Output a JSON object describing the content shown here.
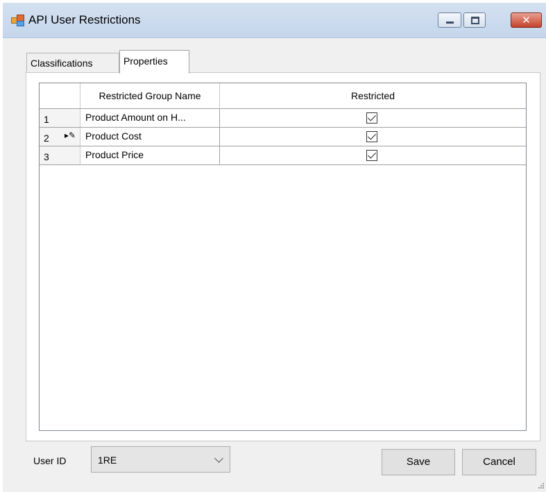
{
  "window": {
    "title": "API User Restrictions",
    "close_glyph": "✕"
  },
  "tabs": [
    {
      "label": "Classifications",
      "active": false
    },
    {
      "label": "Properties",
      "active": true
    }
  ],
  "grid": {
    "columns": [
      "Restricted Group Name",
      "Restricted"
    ],
    "rows": [
      {
        "num": "1",
        "name": "Product Amount on H...",
        "restricted": true,
        "indicator": ""
      },
      {
        "num": "2",
        "name": "Product Cost",
        "restricted": true,
        "indicator": "▸✎"
      },
      {
        "num": "3",
        "name": "Product Price",
        "restricted": true,
        "indicator": ""
      }
    ]
  },
  "footer": {
    "user_id_label": "User ID",
    "user_id_value": "1RE",
    "save_label": "Save",
    "cancel_label": "Cancel"
  },
  "icons": {
    "app": "app-icon",
    "minimize": "minimize-icon",
    "maximize": "maximize-icon",
    "close": "close-icon",
    "dropdown": "chevron-down-icon",
    "edit_row": "row-edit-indicator-icon",
    "grip": "resize-grip-icon"
  }
}
